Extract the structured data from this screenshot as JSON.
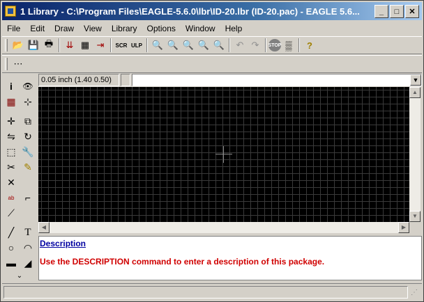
{
  "window": {
    "title": "1 Library - C:\\Program Files\\EAGLE-5.6.0\\lbr\\ID-20.lbr (ID-20.pac) - EAGLE 5.6...",
    "minimize": "_",
    "maximize": "□",
    "close": "✕"
  },
  "menu": [
    "File",
    "Edit",
    "Draw",
    "View",
    "Library",
    "Options",
    "Window",
    "Help"
  ],
  "toolbar": {
    "open": "📂",
    "save": "💾",
    "print": "🖶",
    "cam1": "⇊",
    "cam2": "▦",
    "cam3": "⇥",
    "script": "SCR",
    "ulp": "ULP",
    "zoom_fit": "🔍",
    "zoom_in": "🔍",
    "zoom_out": "🔍",
    "zoom_select": "🔍",
    "zoom_redraw": "🔍",
    "undo": "↶",
    "redo": "↷",
    "stop": "STOP",
    "go": "▒",
    "help": "?"
  },
  "grid_toolbar": {
    "grid_icon": "⋯"
  },
  "coordinates": "0.05 inch (1.40 0.50)",
  "command": {
    "value": "",
    "placeholder": ""
  },
  "tools": {
    "info": "i",
    "show": "👁",
    "display": "▦",
    "mark": "⊹",
    "move": "✛",
    "copy": "⧉",
    "mirror": "⇋",
    "rotate": "↻",
    "group": "⬚",
    "change": "🔧",
    "cut": "✂",
    "paste": "✎",
    "delete": "✕",
    "name": "ab",
    "value": "10k",
    "smash": "⟋",
    "miter": "⌐",
    "split": "⟋",
    "wire": "╱",
    "text": "T",
    "circle": "○",
    "arc": "◠",
    "rect": "▬",
    "polygon": "◢",
    "more": "⌄"
  },
  "description": {
    "link": "Description",
    "text": "Use the DESCRIPTION command to enter a description of this package."
  },
  "status": "",
  "colors": {
    "title_start": "#0a246a",
    "title_end": "#a6caf0",
    "canvas": "#000000",
    "link": "#0000a0",
    "desc_text": "#d00000"
  }
}
